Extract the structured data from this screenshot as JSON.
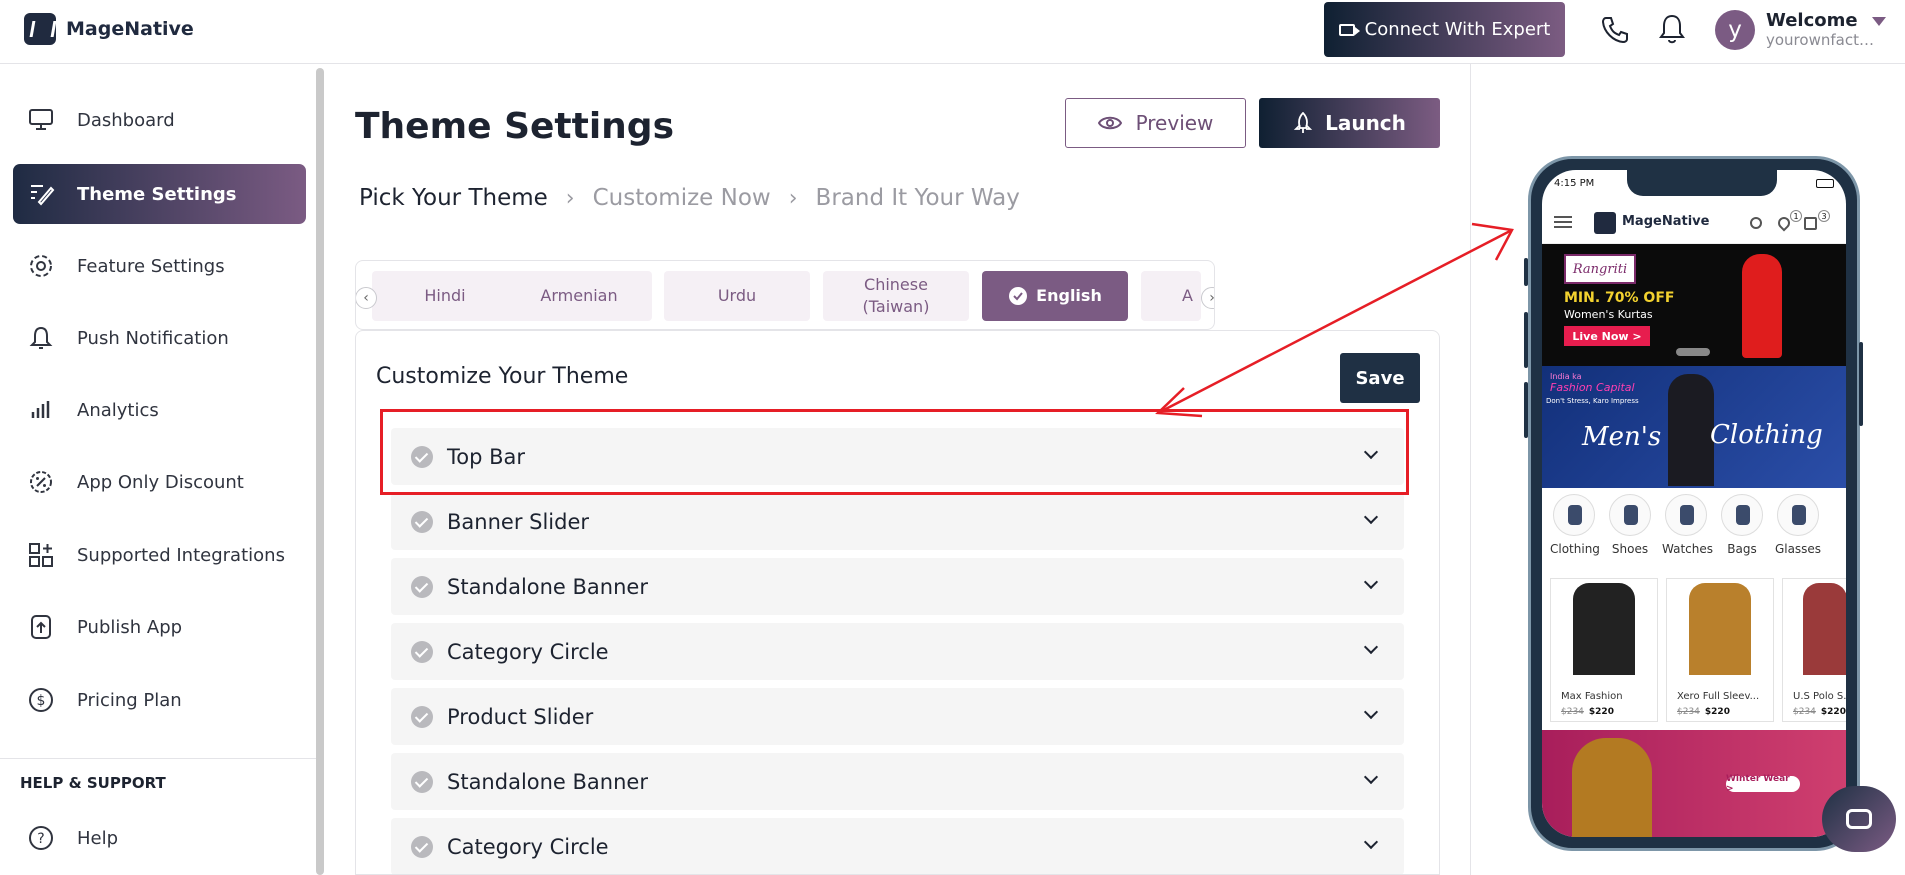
{
  "header": {
    "logo_text": "MageNative",
    "connect_label": "Connect With Expert",
    "welcome": "Welcome",
    "username": "yourownfacto...",
    "avatar_letter": "y"
  },
  "sidebar": {
    "items": [
      {
        "label": "Dashboard",
        "icon": "dashboard-icon"
      },
      {
        "label": "Theme Settings",
        "icon": "theme-settings-icon",
        "active": true
      },
      {
        "label": "Feature Settings",
        "icon": "gear-icon"
      },
      {
        "label": "Push Notification",
        "icon": "bell-icon"
      },
      {
        "label": "Analytics",
        "icon": "analytics-icon"
      },
      {
        "label": "App Only Discount",
        "icon": "discount-icon"
      },
      {
        "label": "Supported Integrations",
        "icon": "integrations-icon"
      },
      {
        "label": "Publish App",
        "icon": "publish-icon"
      },
      {
        "label": "Pricing Plan",
        "icon": "dollar-icon"
      }
    ],
    "help_title": "HELP & SUPPORT",
    "help_item": "Help"
  },
  "main": {
    "title": "Theme Settings",
    "preview_label": "Preview",
    "launch_label": "Launch",
    "breadcrumb": [
      "Pick Your Theme",
      "Customize Now",
      "Brand It Your Way"
    ],
    "languages": [
      "Hindi",
      "Armenian",
      "Urdu",
      "Chinese (Taiwan)",
      "English",
      "A"
    ],
    "active_language": "English",
    "panel_title": "Customize Your Theme",
    "save_label": "Save",
    "sections": [
      "Top Bar",
      "Banner Slider",
      "Standalone Banner",
      "Category Circle",
      "Product Slider",
      "Standalone Banner",
      "Category Circle"
    ]
  },
  "preview_phone": {
    "time": "4:15 PM",
    "app_name": "MageNative",
    "wishlist_count": "1",
    "cart_count": "3",
    "banner1": {
      "brand": "Rangriti",
      "headline": "MIN. 70% OFF",
      "sub": "Women's Kurtas",
      "cta": "Live Now >"
    },
    "banner2": {
      "top": "India ka",
      "capital": "Fashion Capital",
      "sub": "Don't Stress, Karo Impress",
      "text1": "Men's",
      "text2": "Clothing"
    },
    "categories": [
      "Clothing",
      "Shoes",
      "Watches",
      "Bags",
      "Glasses"
    ],
    "products": [
      {
        "name": "Max Fashion",
        "old": "$234",
        "price": "$220"
      },
      {
        "name": "Xero Full Sleev...",
        "old": "$234",
        "price": "$220"
      },
      {
        "name": "U.S Polo S...",
        "old": "$234",
        "price": "$220"
      }
    ],
    "banner3_cta": "Winter Wear >"
  },
  "colors": {
    "accent": "#7b5b83",
    "dark": "#1f3144",
    "highlight": "#e61e26"
  }
}
